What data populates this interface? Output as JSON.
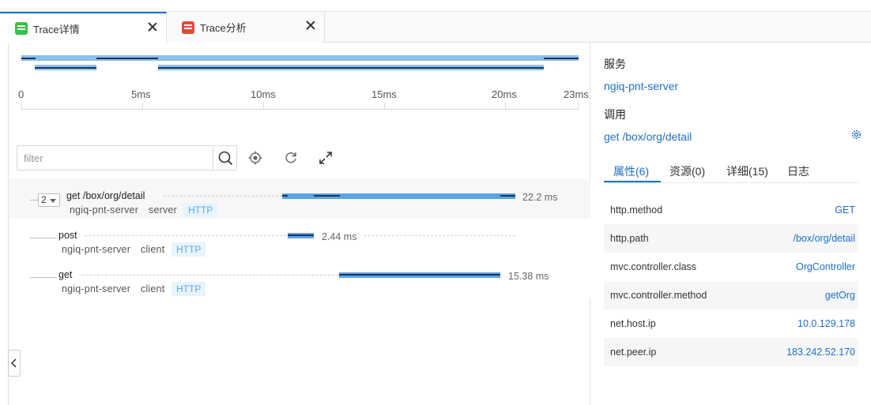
{
  "tabs": [
    {
      "label": "Trace详情",
      "icon": "trace-detail-icon",
      "color": "#3cbf4a",
      "active": true
    },
    {
      "label": "Trace分析",
      "icon": "trace-analysis-icon",
      "color": "#e0483c",
      "active": false
    }
  ],
  "timeline": {
    "ticks": [
      "0",
      "5ms",
      "10ms",
      "15ms",
      "20ms",
      "23ms"
    ]
  },
  "toolbar": {
    "filter_placeholder": "filter",
    "icons": [
      "search-icon",
      "locate-icon",
      "refresh-icon",
      "expand-icon"
    ]
  },
  "spans": [
    {
      "name": "get /box/org/detail",
      "service": "ngiq-pnt-server",
      "kind": "server",
      "tag": "HTTP",
      "duration": "22.2 ms",
      "child_count": "2"
    },
    {
      "name": "post",
      "service": "ngiq-pnt-server",
      "kind": "client",
      "tag": "HTTP",
      "duration": "2.44 ms"
    },
    {
      "name": "get",
      "service": "ngiq-pnt-server",
      "kind": "client",
      "tag": "HTTP",
      "duration": "15.38 ms"
    }
  ],
  "detail": {
    "service_label": "服务",
    "service_value": "ngiq-pnt-server",
    "call_label": "调用",
    "call_value": "get /box/org/detail",
    "tabs": [
      "属性(6)",
      "资源(0)",
      "详细(15)",
      "日志"
    ],
    "attributes": [
      {
        "key": "http.method",
        "value": "GET"
      },
      {
        "key": "http.path",
        "value": "/box/org/detail"
      },
      {
        "key": "mvc.controller.class",
        "value": "OrgController"
      },
      {
        "key": "mvc.controller.method",
        "value": "getOrg"
      },
      {
        "key": "net.host.ip",
        "value": "10.0.129.178"
      },
      {
        "key": "net.peer.ip",
        "value": "183.242.52.170"
      }
    ]
  },
  "colors": {
    "accent": "#1f6fc5",
    "bar": "#5ba3e6",
    "tag_bg": "#e8f4fd"
  }
}
